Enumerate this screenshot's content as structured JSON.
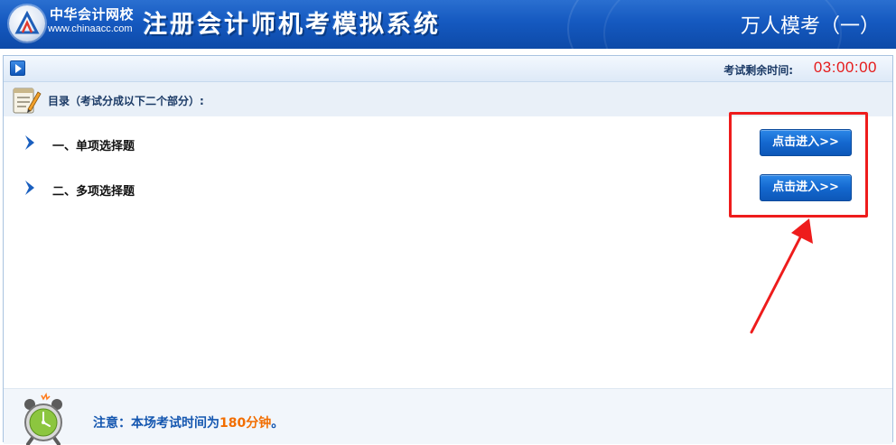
{
  "header": {
    "logo_name_cn": "中华会计网校",
    "logo_url": "www.chinaacc.com",
    "system_title": "注册会计师机考模拟系统",
    "exam_name": "万人模考（一）",
    "colors": {
      "background": "#1559c0",
      "text": "#ffffff"
    }
  },
  "toolbar": {
    "play_icon": "play-icon",
    "timer_label": "考试剩余时间:",
    "timer_value": "03:00:00",
    "timer_color": "#e51b1b"
  },
  "directory": {
    "icon": "notepad-pencil-icon",
    "title": "目录（考试分成以下二个部分）:",
    "sections": [
      {
        "label": "一、单项选择题",
        "button_label": "点击进入>>",
        "icon": "chevron-right-icon"
      },
      {
        "label": "二、多项选择题",
        "button_label": "点击进入>>",
        "icon": "chevron-right-icon"
      }
    ]
  },
  "annotation": {
    "color": "#ee1c1c"
  },
  "footer": {
    "icon": "alarm-clock-icon",
    "notice_prefix": "注意：本场考试时间为",
    "notice_minutes": "180分钟",
    "notice_suffix": "。",
    "notice_color": "#1557b0",
    "highlight_color": "#f26d00"
  }
}
